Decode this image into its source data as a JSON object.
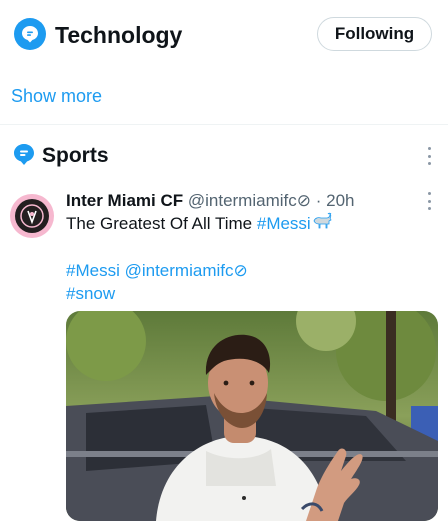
{
  "technology": {
    "title": "Technology",
    "follow_label": "Following",
    "icon": "topic-icon"
  },
  "show_more": "Show more",
  "sports": {
    "title": "Sports",
    "icon": "topic-icon"
  },
  "tweet": {
    "author_name": "Inter Miami CF",
    "handle": "@intermiamifc⊘",
    "time": "20h",
    "text": "The Greatest Of All Time",
    "hashtag_inline": "#Messi",
    "emoji": "goat-emoji",
    "line2_hashtag": "#Messi",
    "line2_mention": "@intermiamifc⊘",
    "line3_hashtag": "#snow",
    "media": "photo"
  },
  "colors": {
    "accent": "#1d9bf0",
    "text": "#0f1419",
    "muted": "#536471",
    "avatar_ring": "#f6b8cf"
  }
}
